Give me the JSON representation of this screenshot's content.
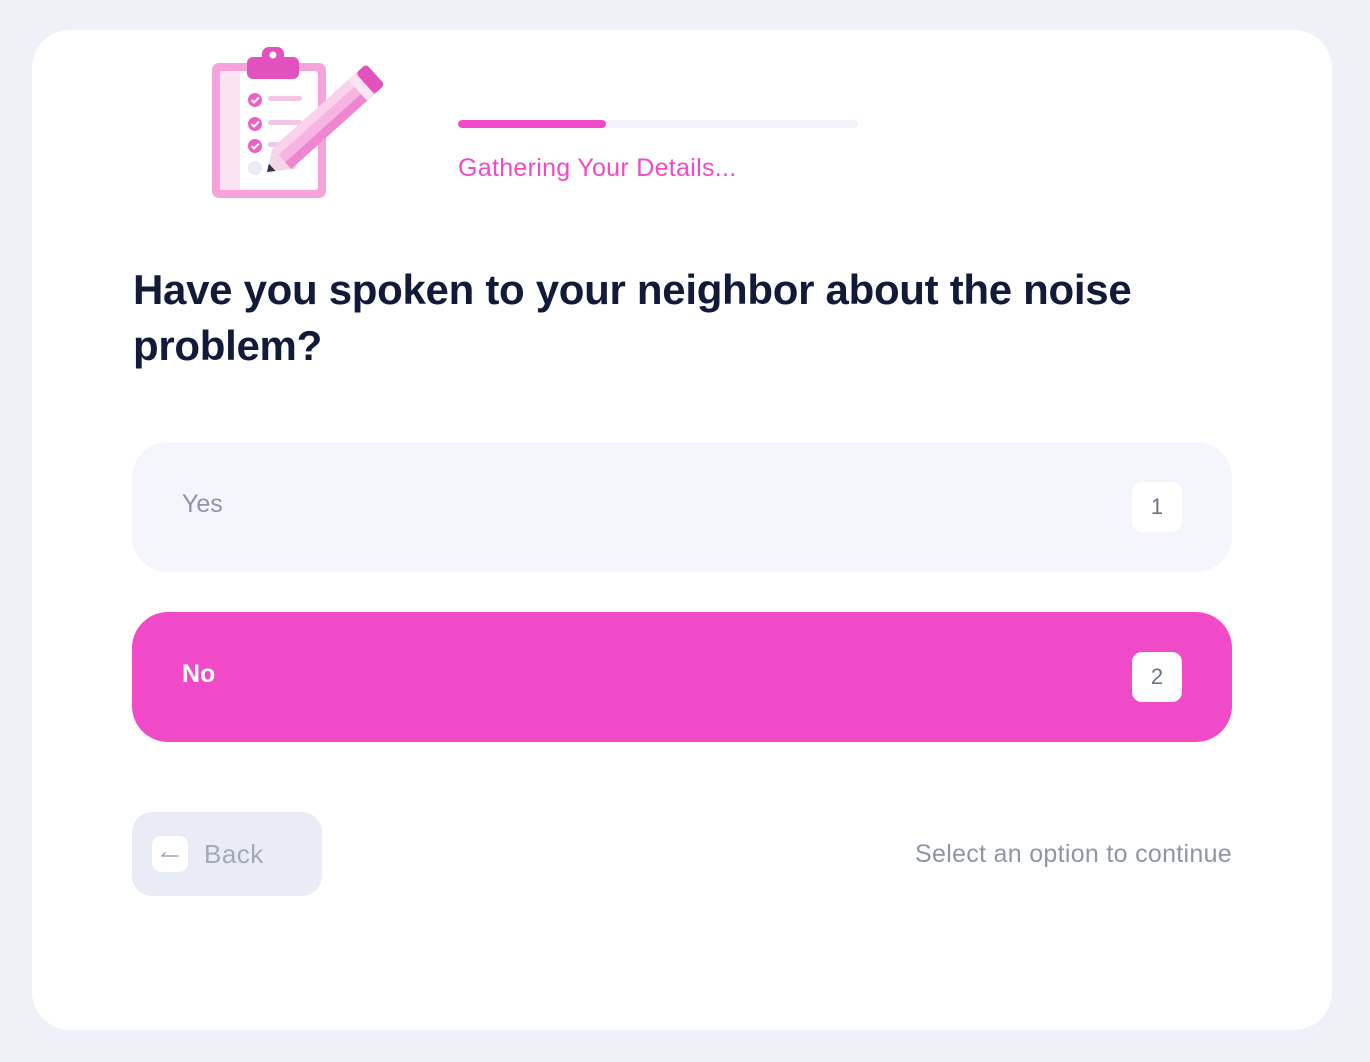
{
  "progress": {
    "fraction": 0.37,
    "label": "Gathering Your Details..."
  },
  "question": {
    "text": "Have you spoken to your neighbor about the noise problem?"
  },
  "options": [
    {
      "label": "Yes",
      "key": "1",
      "selected": false
    },
    {
      "label": "No",
      "key": "2",
      "selected": true
    }
  ],
  "navigation": {
    "back_label": "Back",
    "hint": "Select an option to continue"
  },
  "icons": {
    "illustration": "clipboard-pencil-icon",
    "back": "arrow-left-icon"
  },
  "colors": {
    "accent": "#f14ac9",
    "heading": "#121a3a",
    "muted_text": "#8d95a7",
    "background": "#eef1f8"
  }
}
